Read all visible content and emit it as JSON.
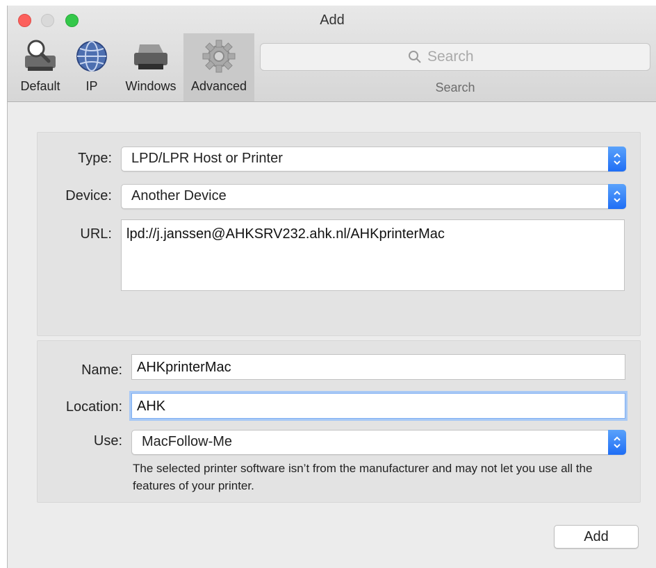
{
  "window": {
    "title": "Add"
  },
  "toolbar": {
    "items": [
      {
        "label": "Default",
        "icon": "printer-magnifier-icon",
        "selected": false
      },
      {
        "label": "IP",
        "icon": "globe-icon",
        "selected": false
      },
      {
        "label": "Windows",
        "icon": "printer-icon",
        "selected": false
      },
      {
        "label": "Advanced",
        "icon": "gear-icon",
        "selected": true
      }
    ],
    "search": {
      "placeholder": "Search",
      "caption": "Search"
    }
  },
  "connection": {
    "type_label": "Type:",
    "type_value": "LPD/LPR Host or Printer",
    "device_label": "Device:",
    "device_value": "Another Device",
    "url_label": "URL:",
    "url_value": "lpd://j.janssen@AHKSRV232.ahk.nl/AHKprinterMac"
  },
  "printer": {
    "name_label": "Name:",
    "name_value": "AHKprinterMac",
    "location_label": "Location:",
    "location_value": "AHK",
    "use_label": "Use:",
    "use_value": "MacFollow-Me",
    "note": "The selected printer software isn’t from the manufacturer and may not let you use all the features of your printer."
  },
  "footer": {
    "add_label": "Add"
  },
  "colors": {
    "accent": "#1f6ef5",
    "focus_ring": "#a8c9f5",
    "close": "#fc605c",
    "zoom": "#34c84a"
  }
}
